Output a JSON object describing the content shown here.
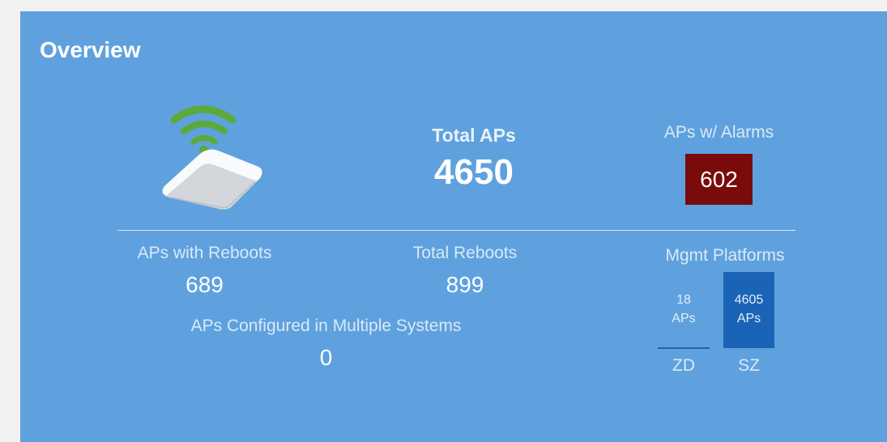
{
  "panel": {
    "title": "Overview"
  },
  "icons": {
    "ap_icon": "wireless-access-point-icon"
  },
  "total_aps": {
    "label": "Total APs",
    "value": "4650"
  },
  "alarms": {
    "label": "APs w/ Alarms",
    "value": "602",
    "color": "#7a0b0b"
  },
  "reboots": {
    "aps_with_reboots_label": "APs with Reboots",
    "aps_with_reboots_value": "689",
    "total_reboots_label": "Total Reboots",
    "total_reboots_value": "899",
    "multi_system_label": "APs Configured in Multiple Systems",
    "multi_system_value": "0"
  },
  "mgmt": {
    "label": "Mgmt Platforms",
    "bar_color": "#1b63b6",
    "platforms": [
      {
        "name": "ZD",
        "count": "18",
        "unit": "APs",
        "value": 18
      },
      {
        "name": "SZ",
        "count": "4605",
        "unit": "APs",
        "value": 4605
      }
    ]
  },
  "colors": {
    "panel_bg": "#5ea1de",
    "page_bg": "#f1f1f1"
  }
}
